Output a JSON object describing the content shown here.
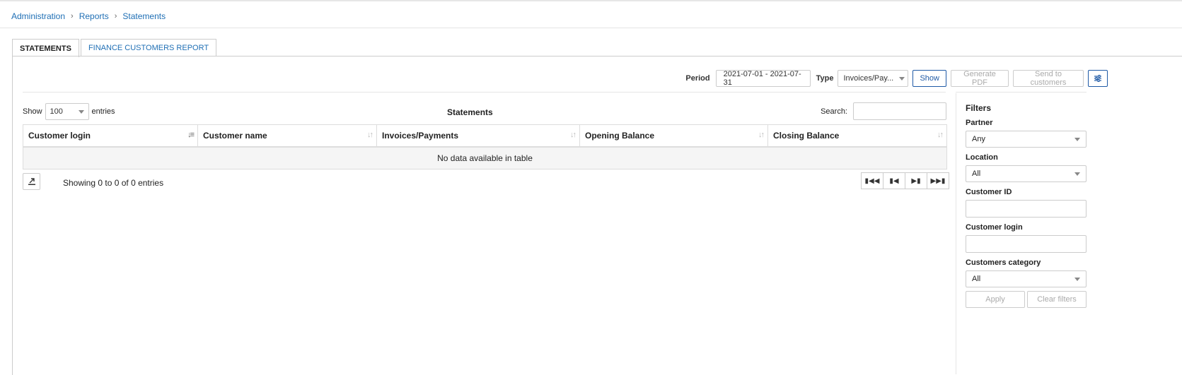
{
  "breadcrumb": [
    "Administration",
    "Reports",
    "Statements"
  ],
  "tabs": [
    {
      "label": "STATEMENTS",
      "active": true
    },
    {
      "label": "FINANCE CUSTOMERS REPORT",
      "active": false
    }
  ],
  "toolbar": {
    "period_label": "Period",
    "period_value": "2021-07-01 - 2021-07-31",
    "type_label": "Type",
    "type_value": "Invoices/Pay...",
    "show_label": "Show",
    "generate_pdf_label": "Generate PDF",
    "send_label": "Send to customers",
    "settings_icon": "sliders-icon"
  },
  "table": {
    "show_label": "Show",
    "entries_value": "100",
    "entries_label": "entries",
    "title": "Statements",
    "search_label": "Search:",
    "columns": [
      "Customer login",
      "Customer name",
      "Invoices/Payments",
      "Opening Balance",
      "Closing Balance"
    ],
    "empty_text": "No data available in table",
    "info": "Showing 0 to 0 of 0 entries"
  },
  "filters": {
    "title": "Filters",
    "partner_label": "Partner",
    "partner_value": "Any",
    "location_label": "Location",
    "location_value": "All",
    "customer_id_label": "Customer ID",
    "customer_login_label": "Customer login",
    "category_label": "Customers category",
    "category_value": "All",
    "apply_label": "Apply",
    "clear_label": "Clear filters"
  },
  "colors": {
    "link": "#1f6fb5",
    "primary": "#1f5aa6"
  }
}
